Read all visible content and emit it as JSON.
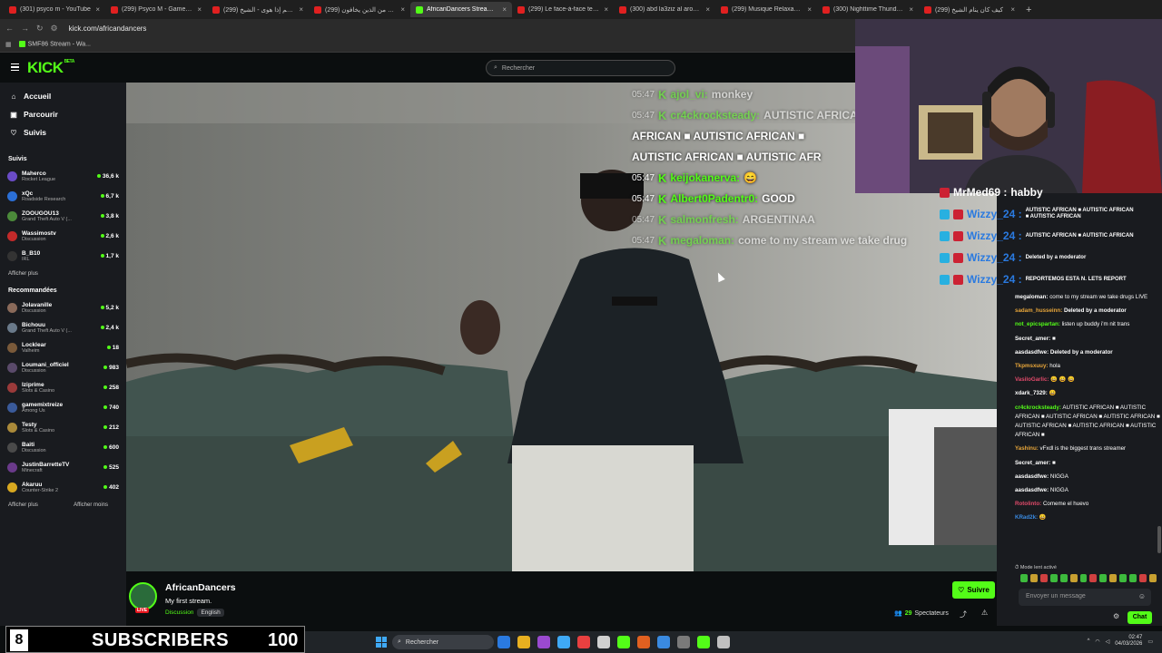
{
  "tabs": [
    {
      "label": "(301) psyco m - YouTube"
    },
    {
      "label": "(299) Psyco M - Gameplay St"
    },
    {
      "label": "(299) و النجم إذا هوى - الشيخ"
    },
    {
      "label": "(299) قال رجلان من الذين يخافون"
    },
    {
      "label": "AfricanDancers Stream - W"
    },
    {
      "label": "(299) Le face-à-face tendu en"
    },
    {
      "label": "(300) abd la3ziz al arousi - Yo"
    },
    {
      "label": "(299) Musique Relaxante pou"
    },
    {
      "label": "(300) Nighttime Thunderstorm"
    },
    {
      "label": "(299) كيف كان ينام الشيخ"
    }
  ],
  "active_tab": 4,
  "address": "kick.com/africandancers",
  "bookmark": "SMF86 Stream - Wa...",
  "search_placeholder": "Rechercher",
  "logo": "KICK",
  "logo_badge": "BETA",
  "nav": [
    {
      "label": "Accueil",
      "icon": "home-icon"
    },
    {
      "label": "Parcourir",
      "icon": "browse-icon"
    },
    {
      "label": "Suivis",
      "icon": "heart-icon"
    }
  ],
  "following_title": "Suivis",
  "following": [
    {
      "name": "Maherco",
      "category": "Rocket League",
      "viewers": "36,6 k",
      "color": "#6a4cc7"
    },
    {
      "name": "xQc",
      "category": "Roadside Research",
      "viewers": "6,7 k",
      "color": "#2b6fd6"
    },
    {
      "name": "ZOOUGOU13",
      "category": "Grand Theft Auto V (...",
      "viewers": "3,8 k",
      "color": "#4b8a3a"
    },
    {
      "name": "Wassimostv",
      "category": "Discussion",
      "viewers": "2,6 k",
      "color": "#c22a2a"
    },
    {
      "name": "B_B10",
      "category": "IRL",
      "viewers": "1,7 k",
      "color": "#333333"
    }
  ],
  "show_more": "Afficher plus",
  "recommended_title": "Recommandées",
  "recommended": [
    {
      "name": "Jolavanille",
      "category": "Discussion",
      "viewers": "5,2 k",
      "color": "#8a6a5a"
    },
    {
      "name": "Bichouu",
      "category": "Grand Theft Auto V (...",
      "viewers": "2,4 k",
      "color": "#6a7a8a"
    },
    {
      "name": "Locklear",
      "category": "Valheim",
      "viewers": "18",
      "color": "#7a5a3a"
    },
    {
      "name": "Loumani_officiel",
      "category": "Discussion",
      "viewers": "983",
      "color": "#5a4a6a"
    },
    {
      "name": "Iziprime",
      "category": "Slots & Casino",
      "viewers": "258",
      "color": "#9a3a3a"
    },
    {
      "name": "gamemixtreize",
      "category": "Among Us",
      "viewers": "740",
      "color": "#3a5a9a"
    },
    {
      "name": "Testy",
      "category": "Slots & Casino",
      "viewers": "212",
      "color": "#aa8a3a"
    },
    {
      "name": "Baiti",
      "category": "Discussion",
      "viewers": "600",
      "color": "#4a4a4a"
    },
    {
      "name": "JustinBarretteTV",
      "category": "Minecraft",
      "viewers": "525",
      "color": "#6a3a8a"
    },
    {
      "name": "Akaruu",
      "category": "Counter-Strike 2",
      "viewers": "402",
      "color": "#d8a820"
    }
  ],
  "show_more2": "Afficher plus",
  "show_less": "Afficher moins",
  "overlay_chat": [
    {
      "time": "05:47",
      "user": "ajol_vi:",
      "msg": "monkey",
      "faded": true
    },
    {
      "time": "05:47",
      "user": "cr4ckrocksteady:",
      "msg": "AUTISTIC AFRICAN",
      "faded": true
    },
    {
      "time": "",
      "user": "",
      "msg": "AFRICAN ■ AUTISTIC AFRICAN ■",
      "faded": false
    },
    {
      "time": "",
      "user": "",
      "msg": "AUTISTIC AFRICAN ■ AUTISTIC AFR",
      "faded": false
    },
    {
      "time": "05:47",
      "user": "keijokanerva:",
      "msg": "😄",
      "faded": false
    },
    {
      "time": "05:47",
      "user": "Albert0Padentr0:",
      "msg": "GOOD",
      "faded": false
    },
    {
      "time": "05:47",
      "user": "salmonfresh:",
      "msg": "ARGENTINAA",
      "faded": true
    },
    {
      "time": "05:47",
      "user": "megaloman:",
      "msg": "come to my stream we take drug",
      "faded": true
    }
  ],
  "channel": {
    "name": "AfricanDancers",
    "title": "My first stream.",
    "tag_category": "Discussion",
    "tag_language": "English",
    "live": "LIVE",
    "follow": "Suivre",
    "viewers_count": "29",
    "viewers_label": "Spectateurs"
  },
  "chat": [
    {
      "user": "megaloman:",
      "color": "#ffffff",
      "msg": "come to my stream we take drugs LIVE"
    },
    {
      "user": "sadam_husseinn:",
      "color": "#e8a63a",
      "msg": "Deleted by a moderator",
      "deleted": true
    },
    {
      "user": "not_epicspartan:",
      "color": "#53fc18",
      "msg": "listen up buddy i'm nit trans"
    },
    {
      "user": "Secret_amer:",
      "color": "#ffffff",
      "msg": "■"
    },
    {
      "user": "aasdasdfwe:",
      "color": "#ffffff",
      "msg": "Deleted by a moderator",
      "deleted": true
    },
    {
      "user": "Tkpmsxuuy:",
      "color": "#e8a63a",
      "msg": "hola"
    },
    {
      "user": "VasiloGarlic:",
      "color": "#e04a6a",
      "msg": "😀 😀 😀"
    },
    {
      "user": "xdark_7329:",
      "color": "#ffffff",
      "msg": "😀"
    },
    {
      "user": "cr4ckrocksteady:",
      "color": "#53fc18",
      "msg": "AUTISTIC AFRICAN ■ AUTISTIC AFRICAN ■ AUTISTIC AFRICAN ■ AUTISTIC AFRICAN ■ AUTISTIC AFRICAN ■ AUTISTIC AFRICAN ■ AUTISTIC AFRICAN ■"
    },
    {
      "user": "Yashinu:",
      "color": "#e8a63a",
      "msg": "vFxdl is the biggest trans streamer"
    },
    {
      "user": "Secret_amer:",
      "color": "#ffffff",
      "msg": "■"
    },
    {
      "user": "aasdasdfwe:",
      "color": "#ffffff",
      "msg": "NIGGA"
    },
    {
      "user": "aasdasdfwe:",
      "color": "#ffffff",
      "msg": "NIGGA"
    },
    {
      "user": "Rotolinto:",
      "color": "#e04a6a",
      "msg": "Comeme el huevo"
    },
    {
      "user": "KRad2k:",
      "color": "#3a8ae0",
      "msg": "😀"
    }
  ],
  "slow_mode": "Mode lent activé",
  "message_placeholder": "Envoyer un message",
  "chat_button": "Chat",
  "stream_chat": [
    {
      "user": "MrMed69 :",
      "msg": "habby",
      "first": true
    },
    {
      "user": "Wizzy_24 :",
      "msg": "AUTISTIC AFRICAN ■ AUTISTIC AFRICAN ■ AUTISTIC AFRICAN"
    },
    {
      "user": "Wizzy_24 :",
      "msg": "AUTISTIC AFRICAN ■ AUTISTIC AFRICAN"
    },
    {
      "user": "Wizzy_24 :",
      "msg": "Deleted by a moderator"
    },
    {
      "user": "Wizzy_24 :",
      "msg": "REPORTEMOS ESTA N. LETS REPORT"
    }
  ],
  "subscribers": {
    "left": "8",
    "label": "SUBSCRIBERS",
    "goal": "100"
  },
  "taskbar": {
    "search": "Rechercher",
    "time": "02:47",
    "date": "04/03/2026"
  }
}
